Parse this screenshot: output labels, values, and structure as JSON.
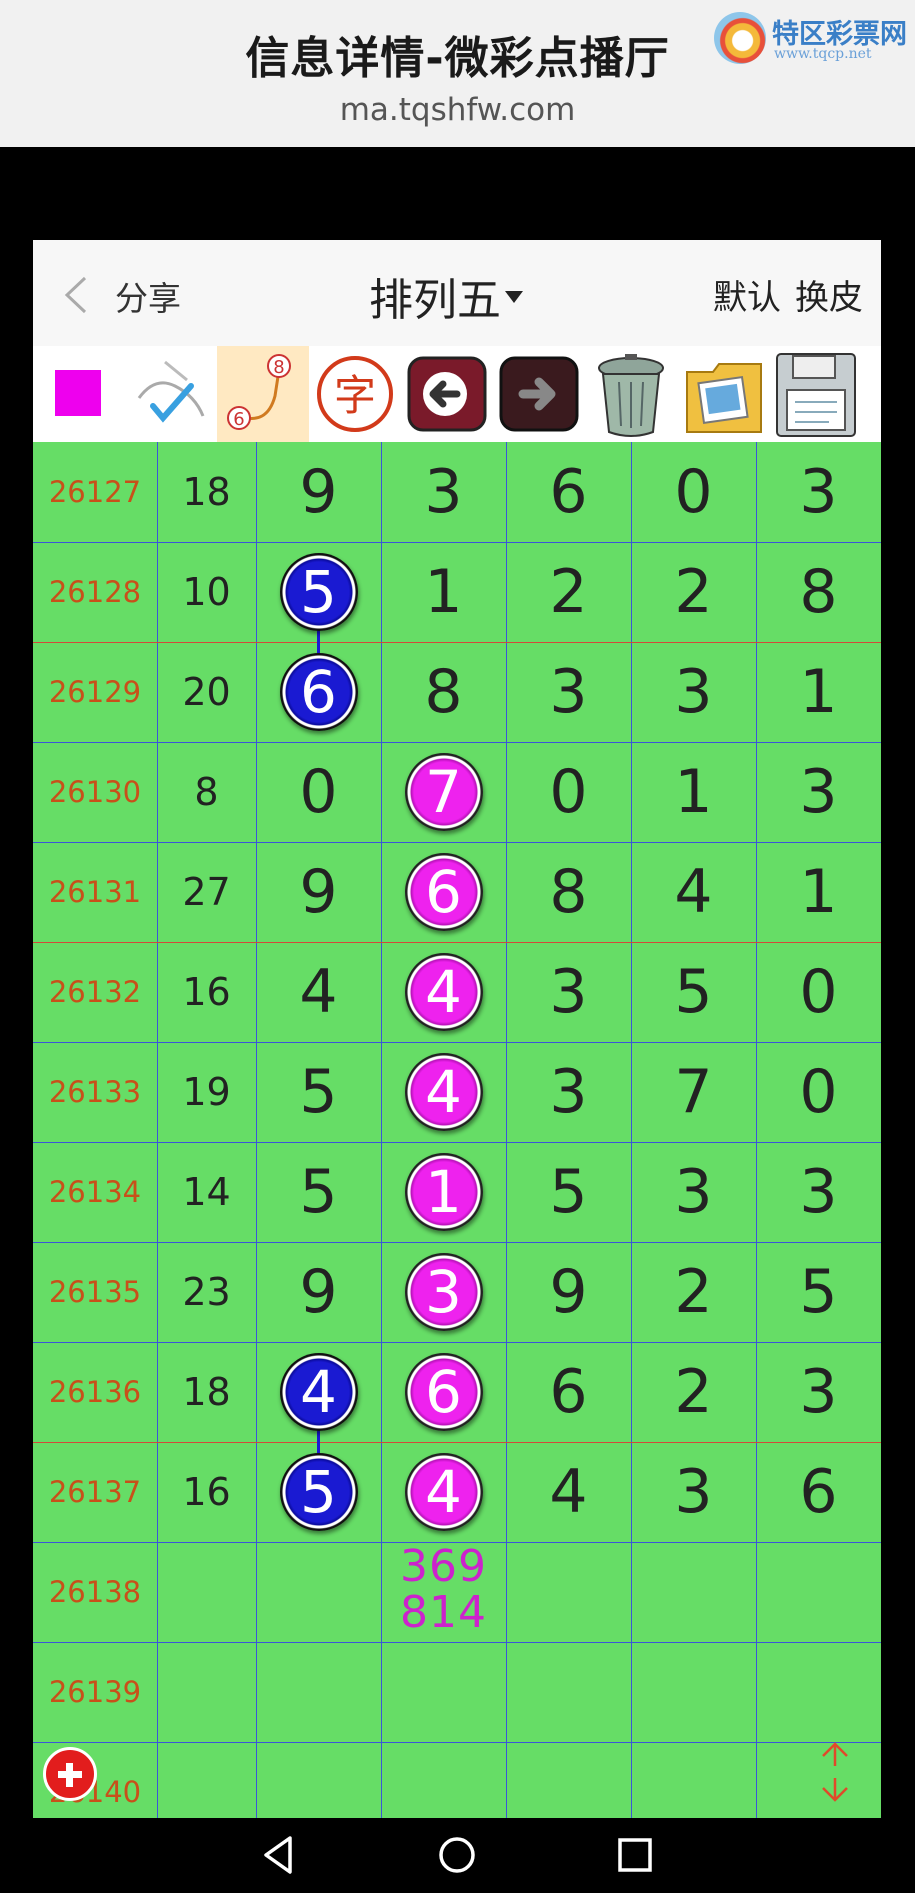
{
  "header": {
    "title": "信息详情-微彩点播厅",
    "url": "ma.tqshfw.com"
  },
  "logo": {
    "text": "特区彩票网",
    "sub": "www.tqcp.net"
  },
  "navbar": {
    "share": "分享",
    "title": "排列五",
    "default": "默认",
    "skin": "换皮"
  },
  "toolbar": [
    {
      "icon": "color-swatch-icon",
      "color": "#ee00ee"
    },
    {
      "icon": "pen-check-icon"
    },
    {
      "icon": "connect-line-icon",
      "label_top": "8",
      "label_bottom": "6"
    },
    {
      "icon": "char-icon",
      "label": "字"
    },
    {
      "icon": "undo-arrow-icon"
    },
    {
      "icon": "redo-arrow-icon"
    },
    {
      "icon": "trash-icon"
    },
    {
      "icon": "gallery-icon"
    },
    {
      "icon": "save-disk-icon"
    }
  ],
  "rows": [
    {
      "issue": "26127",
      "sum": "18",
      "digits": [
        "9",
        "3",
        "6",
        "0",
        "3"
      ]
    },
    {
      "issue": "26128",
      "sum": "10",
      "digits": [
        "5",
        "1",
        "2",
        "2",
        "8"
      ]
    },
    {
      "issue": "26129",
      "sum": "20",
      "digits": [
        "6",
        "8",
        "3",
        "3",
        "1"
      ]
    },
    {
      "issue": "26130",
      "sum": "8",
      "digits": [
        "0",
        "7",
        "0",
        "1",
        "3"
      ]
    },
    {
      "issue": "26131",
      "sum": "27",
      "digits": [
        "9",
        "6",
        "8",
        "4",
        "1"
      ]
    },
    {
      "issue": "26132",
      "sum": "16",
      "digits": [
        "4",
        "4",
        "3",
        "5",
        "0"
      ]
    },
    {
      "issue": "26133",
      "sum": "19",
      "digits": [
        "5",
        "4",
        "3",
        "7",
        "0"
      ]
    },
    {
      "issue": "26134",
      "sum": "14",
      "digits": [
        "5",
        "1",
        "5",
        "3",
        "3"
      ]
    },
    {
      "issue": "26135",
      "sum": "23",
      "digits": [
        "9",
        "3",
        "9",
        "2",
        "5"
      ]
    },
    {
      "issue": "26136",
      "sum": "18",
      "digits": [
        "4",
        "6",
        "6",
        "2",
        "3"
      ]
    },
    {
      "issue": "26137",
      "sum": "16",
      "digits": [
        "5",
        "4",
        "4",
        "3",
        "6"
      ]
    },
    {
      "issue": "26138",
      "sum": "",
      "digits": [
        "",
        "",
        "",
        "",
        ""
      ]
    },
    {
      "issue": "26139",
      "sum": "",
      "digits": [
        "",
        "",
        "",
        "",
        ""
      ]
    },
    {
      "issue": "26140",
      "sum": "",
      "digits": [
        "",
        "",
        "",
        "",
        ""
      ]
    }
  ],
  "highlights": [
    {
      "row": 1,
      "col": 0,
      "style": "blue"
    },
    {
      "row": 2,
      "col": 0,
      "style": "blue"
    },
    {
      "row": 3,
      "col": 1,
      "style": "pink"
    },
    {
      "row": 4,
      "col": 1,
      "style": "pink"
    },
    {
      "row": 5,
      "col": 1,
      "style": "pink"
    },
    {
      "row": 6,
      "col": 1,
      "style": "pink"
    },
    {
      "row": 7,
      "col": 1,
      "style": "pink"
    },
    {
      "row": 8,
      "col": 1,
      "style": "pink"
    },
    {
      "row": 9,
      "col": 0,
      "style": "blue"
    },
    {
      "row": 9,
      "col": 1,
      "style": "pink"
    },
    {
      "row": 10,
      "col": 0,
      "style": "blue"
    },
    {
      "row": 10,
      "col": 1,
      "style": "pink"
    }
  ],
  "connectors": [
    {
      "col": 0,
      "from": 1,
      "to": 2
    },
    {
      "col": 0,
      "from": 9,
      "to": 10
    }
  ],
  "red_separators_after": [
    1,
    4,
    9
  ],
  "prediction": {
    "row": 11,
    "col": 1,
    "line1": "369",
    "line2": "814"
  },
  "colors": {
    "grid_bg": "#66dd66",
    "blue_ball": "#1a1ad2",
    "pink_ball": "#ee22ee",
    "issue_text": "#c8501a"
  }
}
